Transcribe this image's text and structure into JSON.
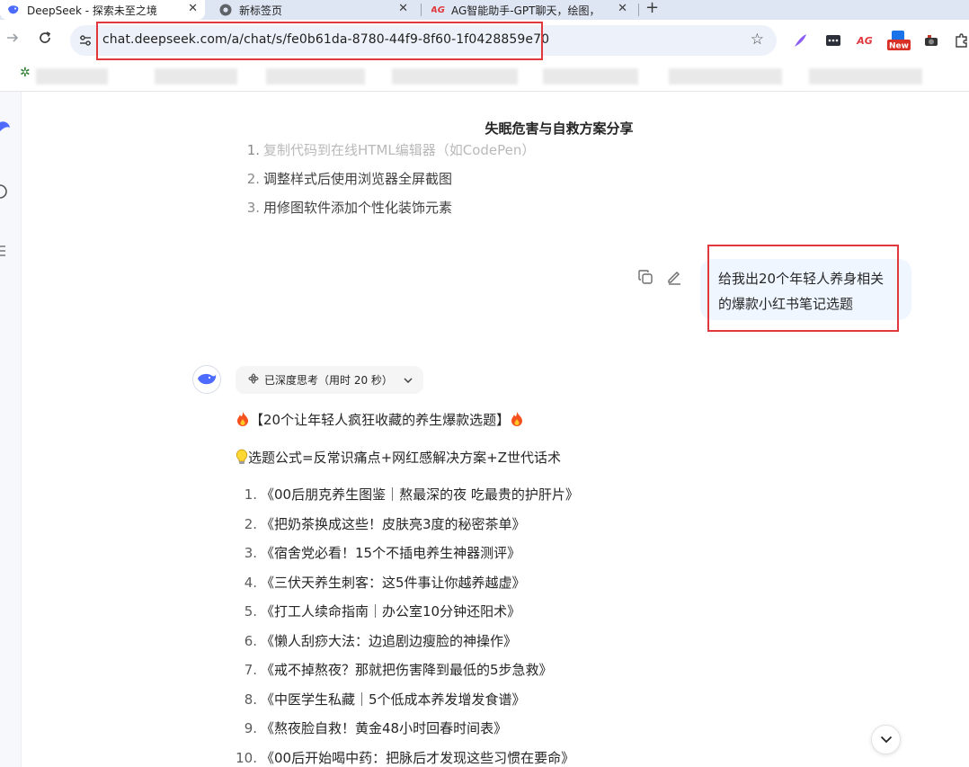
{
  "browser": {
    "tabs": [
      {
        "title": "DeepSeek - 探索未至之境",
        "active": true
      },
      {
        "title": "新标签页",
        "active": false
      },
      {
        "title": "AG智能助手-GPT聊天，绘图，",
        "active": false
      }
    ],
    "new_tab_glyph": "+",
    "close_glyph": "✕",
    "url": "chat.deepseek.com/a/chat/s/fe0b61da-8780-44f9-8f60-1f0428859e70",
    "extensions": [
      "feather-icon",
      "dots-icon",
      "ag-icon",
      "new-badge-icon",
      "camera-icon",
      "puzzle-icon"
    ],
    "ext_ag_label": "AG",
    "ext_new_label": "New"
  },
  "chat": {
    "title": "失眠危害与自救方案分享",
    "previous_answer_list": [
      {
        "num": "1.",
        "text": "复制代码到在线HTML编辑器（如CodePen）"
      },
      {
        "num": "2.",
        "text": "调整样式后使用浏览器全屏截图"
      },
      {
        "num": "3.",
        "text": "用修图软件添加个性化装饰元素"
      }
    ],
    "user_message": {
      "line1": "给我出20个年轻人养身相关",
      "line2": "的爆款小红书笔记选题"
    },
    "assistant": {
      "think_label": "已深度思考（用时 20 秒）",
      "headline": "【20个让年轻人疯狂收藏的养生爆款选题】",
      "formula": "选题公式=反常识痛点+网红感解决方案+Z世代话术",
      "topics": [
        {
          "num": "1.",
          "text": "《00后朋克养生图鉴｜熬最深的夜 吃最贵的护肝片》"
        },
        {
          "num": "2.",
          "text": "《把奶茶换成这些！皮肤亮3度的秘密茶单》"
        },
        {
          "num": "3.",
          "text": "《宿舍党必看！15个不插电养生神器测评》"
        },
        {
          "num": "4.",
          "text": "《三伏天养生刺客：这5件事让你越养越虚》"
        },
        {
          "num": "5.",
          "text": "《打工人续命指南｜办公室10分钟还阳术》"
        },
        {
          "num": "6.",
          "text": "《懒人刮痧大法：边追剧边瘦脸的神操作》"
        },
        {
          "num": "7.",
          "text": "《戒不掉熬夜？那就把伤害降到最低的5步急救》"
        },
        {
          "num": "8.",
          "text": "《中医学生私藏｜5个低成本养发增发食谱》"
        },
        {
          "num": "9.",
          "text": "《熬夜脸自救！黄金48小时回春时间表》"
        },
        {
          "num": "10.",
          "text": "《00后开始喝中药：把脉后才发现这些习惯在要命》"
        }
      ]
    }
  },
  "colors": {
    "accent": "#4d6bfe",
    "highlight_box": "#e0383d",
    "user_bubble": "#eff6ff"
  }
}
